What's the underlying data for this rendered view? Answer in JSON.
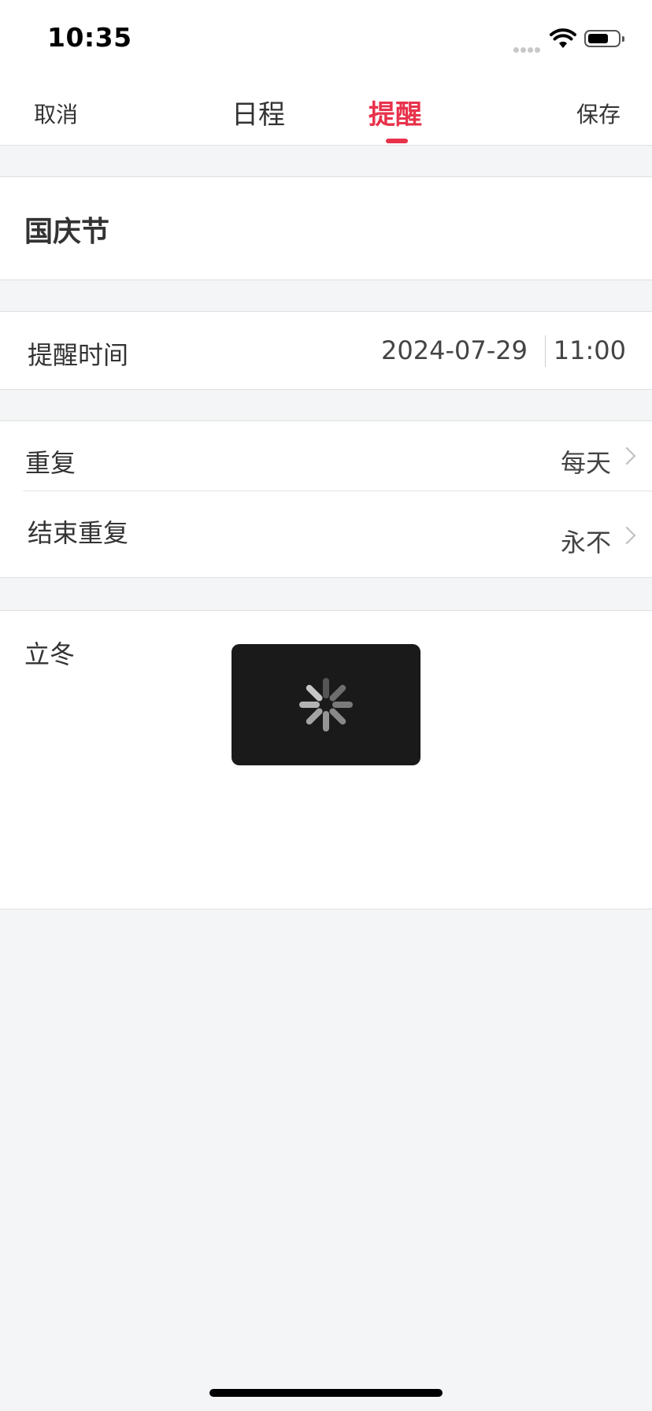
{
  "status_bar": {
    "time": "10:35"
  },
  "nav": {
    "cancel": "取消",
    "save": "保存",
    "tabs": [
      "日程",
      "提醒"
    ],
    "active_tab": "提醒"
  },
  "event": {
    "title": "国庆节"
  },
  "reminder_time": {
    "label": "提醒时间",
    "date": "2024-07-29",
    "time": "11:00"
  },
  "repeat": {
    "label": "重复",
    "value": "每天"
  },
  "end_repeat": {
    "label": "结束重复",
    "value": "永不"
  },
  "note": {
    "text": "立冬"
  },
  "colors": {
    "accent": "#e8324b",
    "background": "#f4f5f7",
    "hud": "#1a1a1a"
  },
  "icons": [
    "signal-dots-icon",
    "wifi-icon",
    "battery-icon",
    "chevron-right-icon",
    "loading-spinner-icon"
  ]
}
